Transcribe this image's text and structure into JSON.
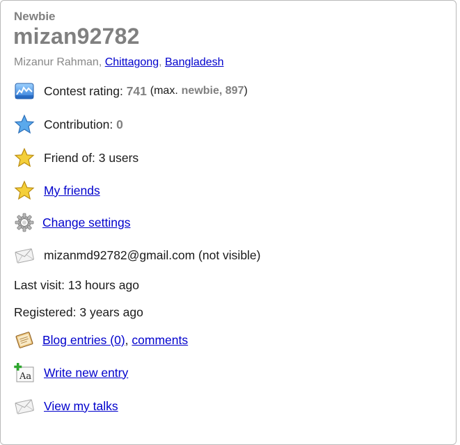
{
  "profile": {
    "rank": "Newbie",
    "handle": "mizan92782",
    "name": "Mizanur Rahman",
    "city": "Chittagong",
    "country": "Bangladesh"
  },
  "rating": {
    "label": "Contest rating:",
    "value": "741",
    "max_prefix": "(max.",
    "max_rank_value": "newbie, 897",
    "max_suffix": ")"
  },
  "contribution": {
    "label": "Contribution:",
    "value": "0"
  },
  "friend_of": {
    "text": "Friend of: 3 users"
  },
  "links": {
    "my_friends": "My friends",
    "change_settings": "Change settings",
    "blog_entries": "Blog entries (0)",
    "comments": "comments",
    "write_new_entry": "Write new entry",
    "view_my_talks": "View my talks"
  },
  "email": {
    "text": "mizanmd92782@gmail.com (not visible)"
  },
  "last_visit": {
    "text": "Last visit: 13 hours ago"
  },
  "registered": {
    "text": "Registered: 3 years ago"
  },
  "icons": {
    "rating": "rating-chart-icon",
    "contribution": "blue-star-icon",
    "friend_of": "gold-star-icon",
    "my_friends": "gold-star-icon",
    "settings": "gear-icon",
    "email": "envelope-icon",
    "blog": "blog-notepad-icon",
    "write": "new-entry-icon",
    "talks": "envelope-icon"
  },
  "colors": {
    "link": "#0000cc",
    "newbie_grey": "#808080",
    "text": "#1a1a1a"
  }
}
